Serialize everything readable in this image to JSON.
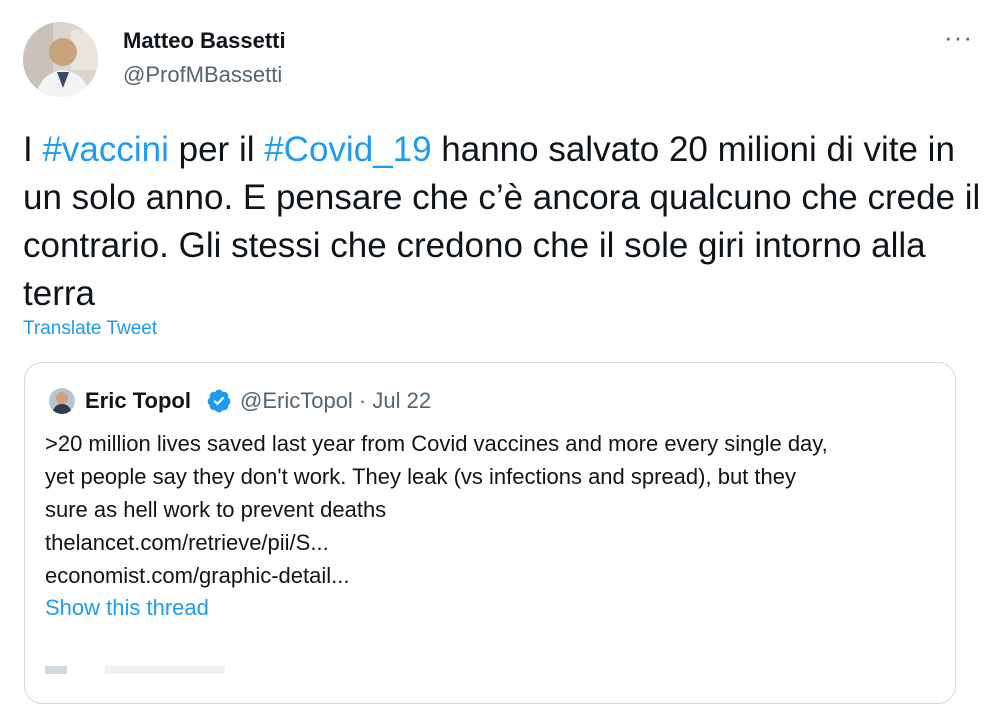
{
  "author": {
    "name": "Matteo Bassetti",
    "handle": "@ProfMBassetti"
  },
  "more_icon_label": "···",
  "tweet": {
    "text_1": "I ",
    "hashtag_1": "#vaccini",
    "text_2": " per il ",
    "hashtag_2": "#Covid_19",
    "text_3": " hanno salvato 20 milioni di vite in un solo anno. E pensare che c’è ancora qualcuno che crede il contrario. Gli stessi che credono che il sole giri intorno alla terra"
  },
  "translate_label": "Translate Tweet",
  "quote": {
    "name": "Eric Topol",
    "meta": "@EricTopol · Jul 22",
    "lines": [
      ">20 million lives saved last year from Covid vaccines and more every single day,",
      "yet people say they don't work. They leak (vs infections and spread), but they",
      "sure as hell work to prevent deaths",
      "thelancet.com/retrieve/pii/S...",
      "economist.com/graphic-detail..."
    ],
    "show_thread": "Show this thread"
  },
  "colors": {
    "accent": "#1d9bf0",
    "text": "#0f1419",
    "muted": "#536471",
    "border": "#cfd9de"
  },
  "icons": [
    "avatar",
    "more-icon",
    "verified-badge-icon",
    "quote-avatar"
  ]
}
